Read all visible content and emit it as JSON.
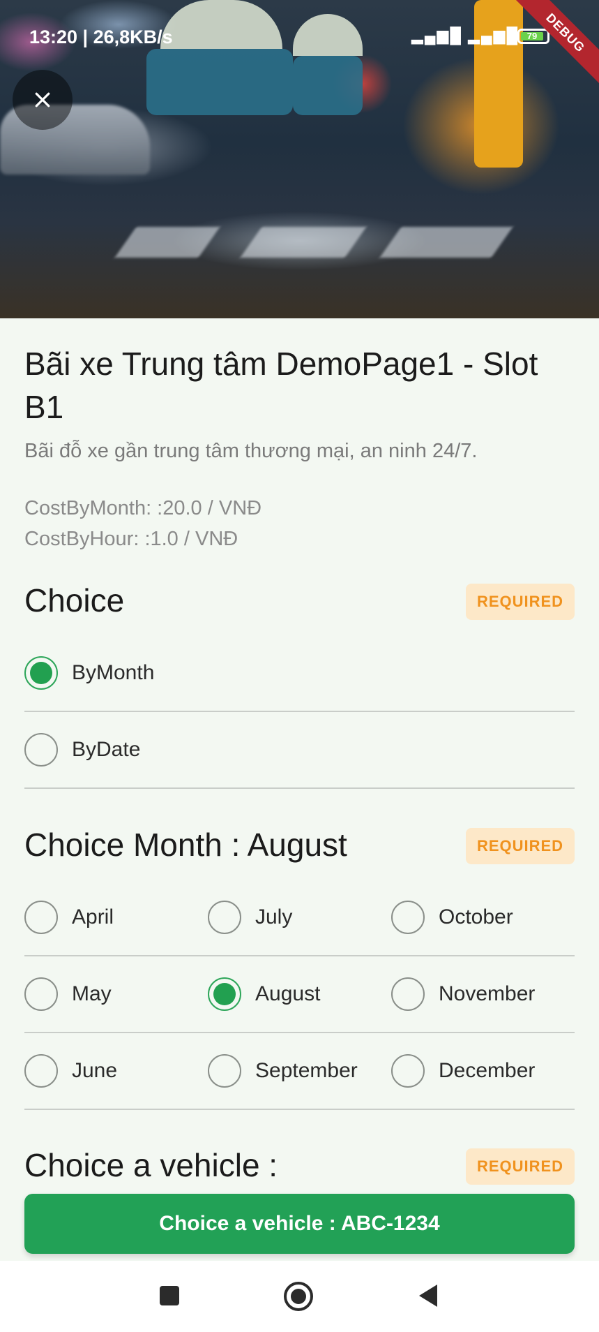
{
  "status_bar": {
    "time": "13:20 | 26,8KB/s",
    "signal_icons": "▂▄▆█ ▂▄▆█",
    "battery": "79",
    "debug_banner": "DEBUG"
  },
  "header": {
    "close_icon": "close-icon",
    "image_desc_icon": "parking-photo"
  },
  "parking": {
    "title": "Bãi xe Trung tâm DemoPage1    - Slot B1",
    "description": "Bãi đỗ xe gần trung tâm thương mại, an ninh 24/7.",
    "cost_by_month": "CostByMonth: :20.0 / VNĐ",
    "cost_by_hour": "CostByHour: :1.0 / VNĐ"
  },
  "choice": {
    "title": "Choice",
    "badge": "REQUIRED",
    "options": [
      {
        "label": "ByMonth",
        "selected": true
      },
      {
        "label": "ByDate",
        "selected": false
      }
    ]
  },
  "month": {
    "title": "Choice Month : August",
    "badge": "REQUIRED",
    "options": [
      {
        "label": "April",
        "selected": false
      },
      {
        "label": "July",
        "selected": false
      },
      {
        "label": "October",
        "selected": false
      },
      {
        "label": "May",
        "selected": false
      },
      {
        "label": "August",
        "selected": true
      },
      {
        "label": "November",
        "selected": false
      },
      {
        "label": "June",
        "selected": false
      },
      {
        "label": "September",
        "selected": false
      },
      {
        "label": "December",
        "selected": false
      }
    ]
  },
  "vehicle": {
    "title": "Choice a vehicle :",
    "badge": "REQUIRED",
    "button_label": "Choice a vehicle : ABC-1234"
  },
  "colors": {
    "accent": "#22a156",
    "badge_bg": "#fde8c8",
    "badge_text": "#f0921e",
    "background": "#f3f8f2"
  }
}
